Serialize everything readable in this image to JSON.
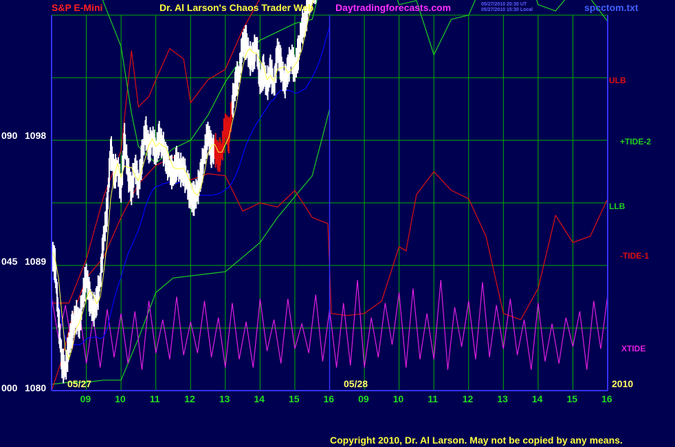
{
  "header": {
    "symbol": "S&P E-Mini",
    "title": "Dr. Al Larson's Chaos Trader Web",
    "site": "Daytradingforecasts.com",
    "stamp_ut": "05/27/2010 20:30 UT",
    "stamp_local": "05/27/2010 15:30 Local",
    "file": "spcctom.txt"
  },
  "footer": {
    "copyright": "Copyright 2010, Dr. Al Larson. May not be copied by any means."
  },
  "colors": {
    "background": "#000050",
    "grid": "#00b000",
    "axis": "#3333ff",
    "price": "#ffffff",
    "red": "#e01010",
    "green": "#20d020",
    "xtide": "#e020e0",
    "ma": "#0000ff",
    "ma_short": "#ffff40"
  },
  "chart_data": {
    "type": "line",
    "y_axis": {
      "ticks": [
        {
          "value": 1098,
          "label": "1098",
          "scale": "090"
        },
        {
          "value": 1089,
          "label": "1089",
          "scale": "045"
        },
        {
          "value": 1080,
          "label": "1080",
          "scale": "000"
        }
      ]
    },
    "ylim": [
      1080,
      1098
    ],
    "x_axis": {
      "hour_ticks": [
        "09",
        "10",
        "11",
        "12",
        "13",
        "14",
        "15",
        "16",
        "09",
        "10",
        "11",
        "12",
        "13",
        "14",
        "15",
        "16"
      ],
      "date_labels": [
        "05/27",
        "05/28"
      ],
      "year": "2010"
    },
    "xlim": [
      0,
      16
    ],
    "series_labels": [
      {
        "name": "ULB",
        "color": "#e01010"
      },
      {
        "name": "+TIDE-2",
        "color": "#20d020"
      },
      {
        "name": "LLB",
        "color": "#20d020"
      },
      {
        "name": "-TIDE-1",
        "color": "#e01010"
      },
      {
        "name": "XTIDE",
        "color": "#e020e0"
      }
    ],
    "price": {
      "x": [
        0.0,
        0.1,
        0.2,
        0.3,
        0.4,
        0.5,
        0.6,
        0.7,
        0.8,
        0.9,
        1.0,
        1.1,
        1.2,
        1.3,
        1.4,
        1.5,
        1.6,
        1.7,
        1.8,
        1.9,
        2.0,
        2.1,
        2.2,
        2.3,
        2.4,
        2.5,
        2.6,
        2.7,
        2.8,
        2.9,
        3.0,
        3.1,
        3.2,
        3.3,
        3.4,
        3.5,
        3.6,
        3.7,
        3.8,
        3.9,
        4.0,
        4.1,
        4.2,
        4.3,
        4.4,
        4.5,
        4.6,
        4.7,
        4.8,
        4.9,
        5.0,
        5.1,
        5.2,
        5.3,
        5.4,
        5.5,
        5.6,
        5.7,
        5.8,
        5.9,
        6.0,
        6.1,
        6.2,
        6.3,
        6.4,
        6.5,
        6.6,
        6.7,
        6.8,
        6.9,
        7.0,
        7.1,
        7.2,
        7.3,
        7.4,
        7.5,
        7.6,
        7.7,
        7.8,
        7.9,
        8.0
      ],
      "y": [
        1086.7,
        1086.0,
        1083.5,
        1081.3,
        1081.0,
        1082.2,
        1083.0,
        1083.6,
        1083.2,
        1084.5,
        1085.5,
        1084.4,
        1083.8,
        1084.3,
        1085.3,
        1087.3,
        1088.7,
        1091.6,
        1090.4,
        1090.7,
        1089.6,
        1092.0,
        1090.5,
        1089.6,
        1090.8,
        1089.8,
        1091.2,
        1092.5,
        1091.6,
        1092.1,
        1091.4,
        1092.1,
        1091.7,
        1091.1,
        1090.6,
        1090.4,
        1090.9,
        1090.6,
        1090.5,
        1090.0,
        1089.3,
        1089.2,
        1089.6,
        1090.4,
        1091.4,
        1092.3,
        1091.5,
        1091.6,
        1091.2,
        1091.5,
        1092.7,
        1092.2,
        1093.7,
        1094.8,
        1095.2,
        1096.6,
        1096.7,
        1095.9,
        1096.0,
        1096.6,
        1094.8,
        1095.3,
        1094.6,
        1095.4,
        1094.5,
        1096.3,
        1095.6,
        1094.7,
        1095.4,
        1096.0,
        1095.4,
        1096.2,
        1097.4,
        1097.7,
        1098.6,
        1099.2,
        1099.4,
        1100.8,
        1102.0,
        1104.6,
        1103.8
      ]
    },
    "series": [
      {
        "name": "ULB",
        "x": [
          0.0,
          0.5,
          1.0,
          1.5,
          2.0,
          2.3,
          2.5,
          2.8,
          3.0,
          3.4,
          3.8,
          4.0,
          4.5,
          5.0,
          5.5,
          6.0,
          6.5,
          7.0,
          7.5,
          7.8,
          8.0
        ],
        "y": [
          1084.2,
          1084.2,
          1086.3,
          1089.3,
          1091.5,
          1096.3,
          1093.6,
          1094.1,
          1094.9,
          1096.4,
          1095.9,
          1093.8,
          1094.9,
          1095.4,
          1097.3,
          1098.8,
          1099.8,
          1100.2,
          1101.3,
          1101.9,
          1103.0
        ]
      },
      {
        "name": "LLB",
        "x": [
          0.0,
          0.5,
          1.0,
          1.5,
          2.0,
          2.5,
          3.0,
          3.5,
          4.0,
          4.5,
          5.0,
          5.5,
          6.0,
          6.5,
          7.0,
          7.5,
          7.8,
          8.0
        ],
        "y": [
          1080.3,
          1080.4,
          1080.4,
          1080.5,
          1080.5,
          1082.5,
          1084.7,
          1085.4,
          1085.5,
          1085.6,
          1085.7,
          1086.4,
          1087.1,
          1088.3,
          1089.3,
          1090.3,
          1092.2,
          1093.5
        ]
      },
      {
        "name": "+TIDE-2",
        "x": [
          0.0,
          0.5,
          1.0,
          1.5,
          2.0,
          2.3,
          2.5,
          3.0,
          3.5,
          4.0,
          4.5,
          5.0,
          5.5,
          6.0,
          6.5,
          7.0,
          7.5,
          8.0,
          8.5,
          9.0,
          9.5,
          10.0,
          10.5,
          11.0,
          11.5,
          12.0,
          12.5,
          13.0,
          13.5,
          14.0,
          14.5,
          15.0,
          15.5,
          16.0
        ],
        "y": [
          1099.0,
          1101.2,
          1101.0,
          1098.6,
          1096.5,
          1093.3,
          1091.7,
          1090.9,
          1091.6,
          1092.0,
          1093.2,
          1094.8,
          1096.0,
          1096.8,
          1097.2,
          1097.6,
          1097.8,
          1101.1,
          1101.2,
          1101.2,
          1101.1,
          1098.5,
          1098.7,
          1096.1,
          1097.8,
          1098.0,
          1099.9,
          1101.5,
          1101.2,
          1098.5,
          1098.2,
          1099.2,
          1098.8,
          1097.7
        ]
      },
      {
        "name": "-TIDE-1",
        "x": [
          0.0,
          0.3,
          0.6,
          1.0,
          1.5,
          2.0,
          2.5,
          3.0,
          3.5,
          4.0,
          4.5,
          5.0,
          5.5,
          6.0,
          6.5,
          7.0,
          7.5,
          7.95,
          8.05,
          8.5,
          9.0,
          9.5,
          10.0,
          10.2,
          10.5,
          11.0,
          11.5,
          12.0,
          12.5,
          13.0,
          13.5,
          14.0,
          14.5,
          15.0,
          15.5,
          16.0
        ],
        "y": [
          1080.0,
          1081.5,
          1083.6,
          1085.4,
          1086.4,
          1088.3,
          1089.9,
          1090.8,
          1091.2,
          1090.1,
          1090.4,
          1090.3,
          1088.6,
          1089.0,
          1088.8,
          1089.6,
          1088.3,
          1088.0,
          1083.7,
          1083.6,
          1083.7,
          1084.3,
          1086.9,
          1086.7,
          1089.4,
          1090.5,
          1089.6,
          1089.2,
          1087.4,
          1083.7,
          1083.4,
          1084.9,
          1088.4,
          1087.1,
          1087.4,
          1089.2
        ]
      },
      {
        "name": "XTIDE",
        "x": [
          0.0,
          0.2,
          0.4,
          0.6,
          0.8,
          1.0,
          1.2,
          1.4,
          1.6,
          1.8,
          2.0,
          2.2,
          2.4,
          2.6,
          2.8,
          3.0,
          3.2,
          3.4,
          3.6,
          3.8,
          4.0,
          4.2,
          4.4,
          4.6,
          4.8,
          5.0,
          5.2,
          5.4,
          5.6,
          5.8,
          6.0,
          6.2,
          6.4,
          6.6,
          6.8,
          7.0,
          7.2,
          7.4,
          7.6,
          7.8,
          8.0,
          8.2,
          8.4,
          8.6,
          8.8,
          9.0,
          9.2,
          9.4,
          9.6,
          9.8,
          10.0,
          10.2,
          10.4,
          10.6,
          10.8,
          11.0,
          11.2,
          11.4,
          11.6,
          11.8,
          12.0,
          12.2,
          12.4,
          12.6,
          12.8,
          13.0,
          13.2,
          13.4,
          13.6,
          13.8,
          14.0,
          14.2,
          14.4,
          14.6,
          14.8,
          15.0,
          15.2,
          15.4,
          15.6,
          15.8,
          16.0
        ],
        "y": [
          1084.5,
          1082.5,
          1084.1,
          1082.0,
          1083.9,
          1081.3,
          1083.5,
          1081.1,
          1083.9,
          1081.6,
          1083.7,
          1081.3,
          1083.8,
          1081.0,
          1084.3,
          1081.8,
          1083.4,
          1081.5,
          1084.5,
          1081.7,
          1083.3,
          1081.8,
          1084.3,
          1081.6,
          1083.5,
          1081.1,
          1084.2,
          1081.5,
          1083.3,
          1081.1,
          1084.4,
          1081.9,
          1083.4,
          1081.3,
          1084.4,
          1082.0,
          1083.2,
          1081.8,
          1084.6,
          1081.4,
          1083.9,
          1081.1,
          1084.2,
          1081.2,
          1085.3,
          1081.1,
          1083.5,
          1081.6,
          1084.2,
          1082.2,
          1084.7,
          1081.1,
          1084.9,
          1081.5,
          1083.7,
          1081.5,
          1085.3,
          1081.0,
          1084.0,
          1082.1,
          1084.3,
          1081.5,
          1085.2,
          1081.6,
          1084.1,
          1082.0,
          1084.4,
          1081.7,
          1083.4,
          1081.0,
          1084.2,
          1081.4,
          1083.2,
          1081.3,
          1083.5,
          1082.1,
          1083.8,
          1081.0,
          1084.3,
          1082.0,
          1084.6
        ]
      }
    ]
  }
}
